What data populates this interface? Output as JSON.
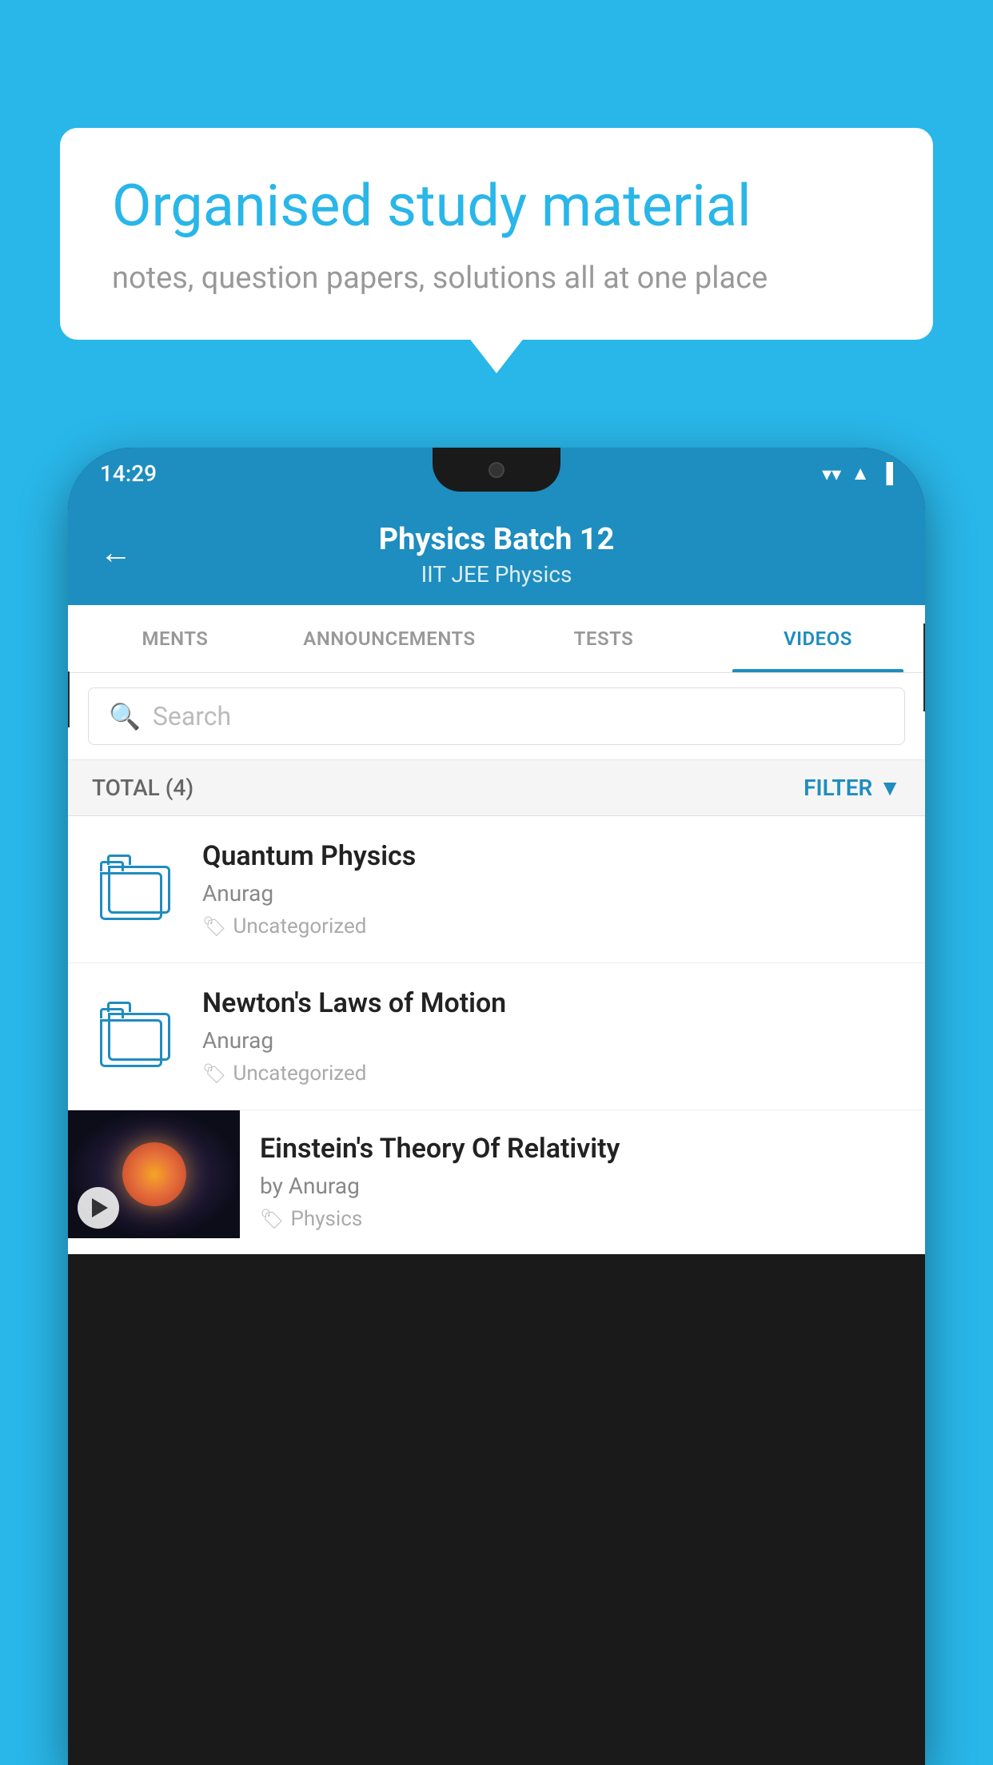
{
  "background_color": "#29b6e8",
  "speech_bubble": {
    "title": "Organised study material",
    "subtitle": "notes, question papers, solutions all at one place"
  },
  "phone": {
    "status_bar": {
      "time": "14:29",
      "icons": [
        "wifi",
        "signal",
        "battery"
      ]
    },
    "header": {
      "title": "Physics Batch 12",
      "subtitle": "IIT JEE   Physics",
      "back_label": "←"
    },
    "tabs": [
      {
        "label": "MENTS",
        "active": false
      },
      {
        "label": "ANNOUNCEMENTS",
        "active": false
      },
      {
        "label": "TESTS",
        "active": false
      },
      {
        "label": "VIDEOS",
        "active": true
      }
    ],
    "search": {
      "placeholder": "Search"
    },
    "filter_bar": {
      "total": "TOTAL (4)",
      "filter_label": "FILTER"
    },
    "videos": [
      {
        "title": "Quantum Physics",
        "author": "Anurag",
        "tag": "Uncategorized",
        "has_thumb": false
      },
      {
        "title": "Newton's Laws of Motion",
        "author": "Anurag",
        "tag": "Uncategorized",
        "has_thumb": false
      },
      {
        "title": "Einstein's Theory Of Relativity",
        "author": "by Anurag",
        "tag": "Physics",
        "has_thumb": true
      }
    ]
  }
}
